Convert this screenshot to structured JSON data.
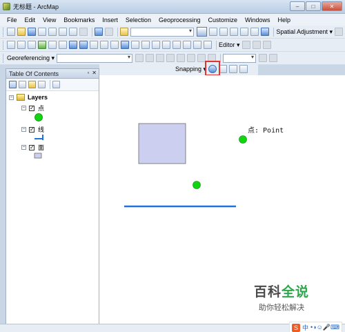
{
  "window": {
    "title": "无标题 - ArcMap",
    "min": "–",
    "max": "□",
    "close": "✕"
  },
  "menu": [
    "File",
    "Edit",
    "View",
    "Bookmarks",
    "Insert",
    "Selection",
    "Geoprocessing",
    "Customize",
    "Windows",
    "Help"
  ],
  "toolbar1": {
    "spatial_adjustment": "Spatial Adjustment ▾"
  },
  "toolbar2": {
    "editor": "Editor ▾"
  },
  "toolbar3": {
    "georeferencing": "Georeferencing ▾"
  },
  "snapping": {
    "label": "Snapping ▾"
  },
  "toc": {
    "title": "Table Of Contents",
    "root": "Layers",
    "layers": [
      {
        "name": "点",
        "checked": true
      },
      {
        "name": "线",
        "checked": true
      },
      {
        "name": "面",
        "checked": true
      }
    ]
  },
  "map": {
    "tooltip": "点: Point"
  },
  "colors": {
    "point": "#11d511",
    "line": "#1e73d9",
    "polygon_fill": "#cccff0",
    "polygon_stroke": "#6a6a6a",
    "highlight": "#e53333"
  },
  "watermark": {
    "title_part1": "百科",
    "title_part2": "全说",
    "subtitle": "助你轻松解决"
  },
  "ime": {
    "label": "中",
    "extras": "•◑☺🎤⌨"
  }
}
